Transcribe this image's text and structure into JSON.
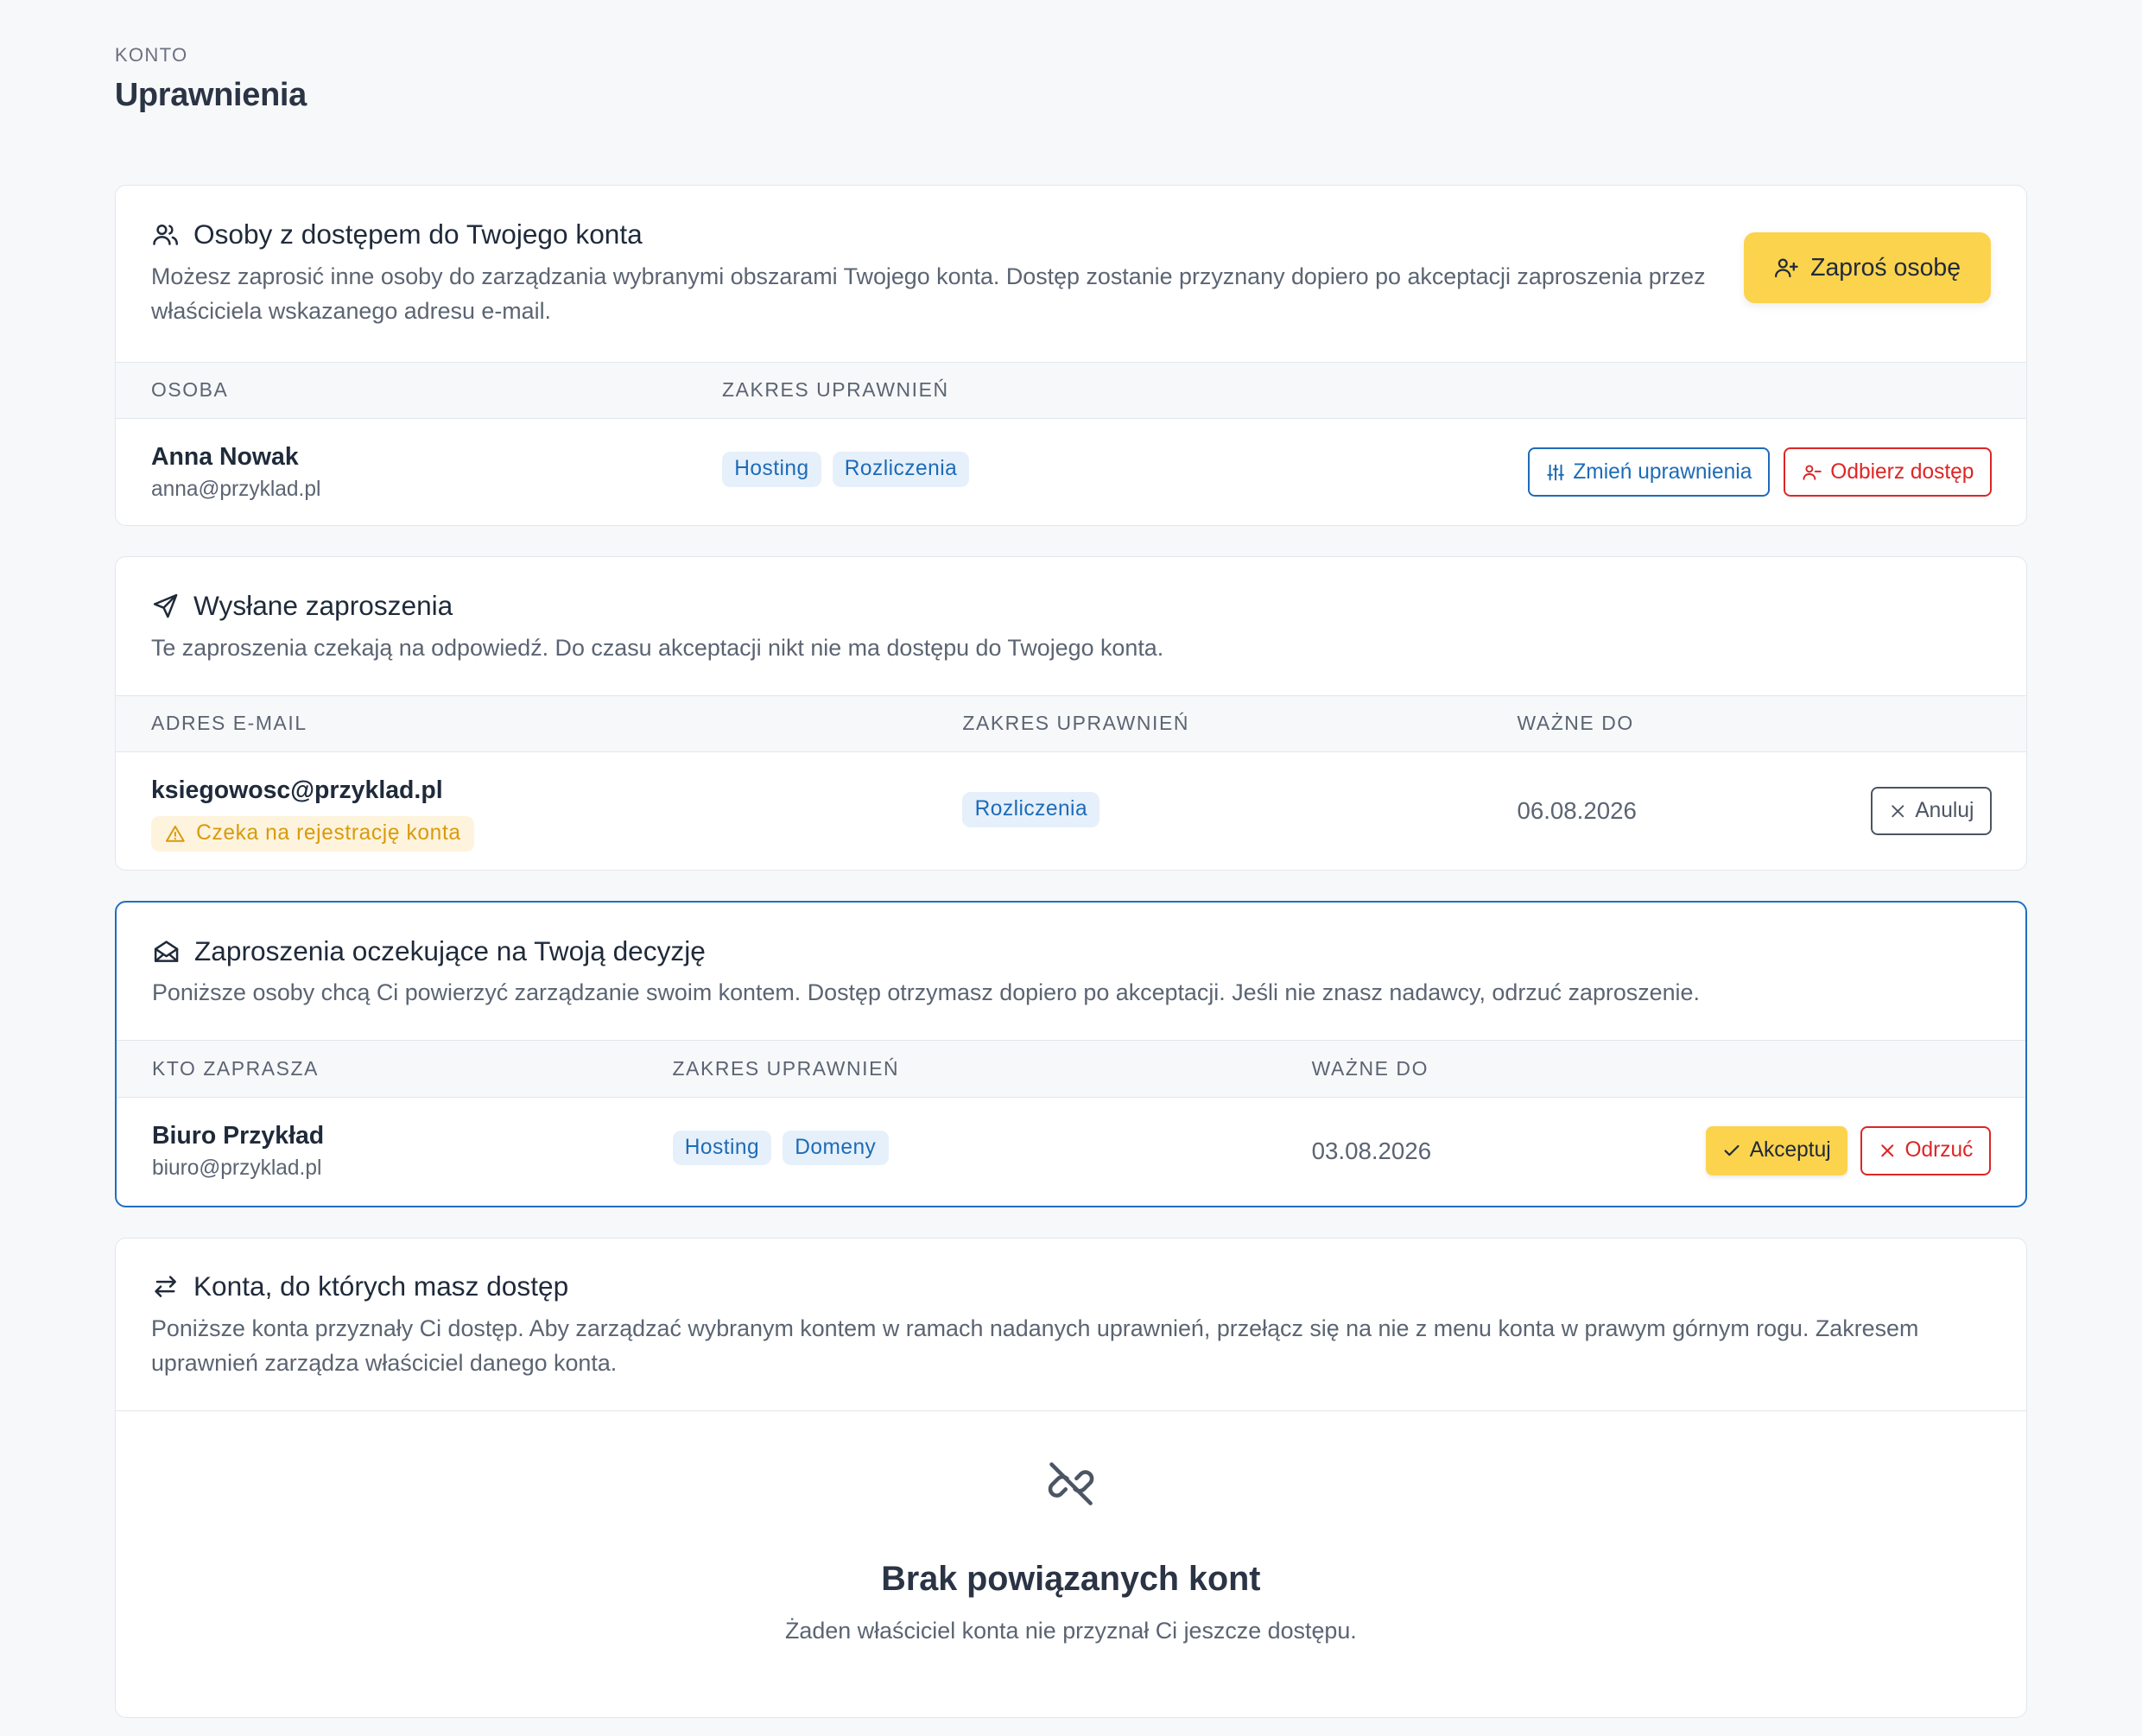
{
  "header": {
    "eyebrow": "KONTO",
    "title": "Uprawnienia"
  },
  "section_access": {
    "title": "Osoby z dostępem do Twojego konta",
    "description": "Możesz zaprosić inne osoby do zarządzania wybranymi obszarami Twojego konta. Dostęp zostanie przyznany dopiero po akceptacji zaproszenia przez właściciela wskazanego adresu e-mail.",
    "invite_label": "Zaproś osobę",
    "columns": [
      "OSOBA",
      "ZAKRES UPRAWNIEŃ"
    ],
    "rows": [
      {
        "name": "Anna Nowak",
        "email": "anna@przyklad.pl",
        "tags": [
          "Hosting",
          "Rozliczenia"
        ],
        "change_label": "Zmień uprawnienia",
        "revoke_label": "Odbierz dostęp"
      }
    ]
  },
  "section_sent": {
    "title": "Wysłane zaproszenia",
    "description": "Te zaproszenia czekają na odpowiedź. Do czasu akceptacji nikt nie ma dostępu do Twojego konta.",
    "columns": [
      "ADRES E-MAIL",
      "ZAKRES UPRAWNIEŃ",
      "WAŻNE DO"
    ],
    "rows": [
      {
        "email": "ksiegowosc@przyklad.pl",
        "status": "Czeka na rejestrację konta",
        "tags": [
          "Rozliczenia"
        ],
        "valid_until": "06.08.2026",
        "cancel_label": "Anuluj"
      }
    ]
  },
  "section_pending": {
    "title": "Zaproszenia oczekujące na Twoją decyzję",
    "description": "Poniższe osoby chcą Ci powierzyć zarządzanie swoim kontem. Dostęp otrzymasz dopiero po akceptacji. Jeśli nie znasz nadawcy, odrzuć zaproszenie.",
    "columns": [
      "KTO ZAPRASZA",
      "ZAKRES UPRAWNIEŃ",
      "WAŻNE DO"
    ],
    "rows": [
      {
        "name": "Biuro Przykład",
        "email": "biuro@przyklad.pl",
        "tags": [
          "Hosting",
          "Domeny"
        ],
        "valid_until": "03.08.2026",
        "accept_label": "Akceptuj",
        "reject_label": "Odrzuć"
      }
    ]
  },
  "section_linked": {
    "title": "Konta, do których masz dostęp",
    "description": "Poniższe konta przyznały Ci dostęp. Aby zarządzać wybranym kontem w ramach nadanych uprawnień, przełącz się na nie z menu konta w prawym górnym rogu. Zakresem uprawnień zarządza właściciel danego konta.",
    "empty_title": "Brak powiązanych kont",
    "empty_description": "Żaden właściciel konta nie przyznał Ci jeszcze dostępu."
  },
  "colors": {
    "accent_yellow": "#fcd34d",
    "link_blue": "#1d6bb8",
    "danger_red": "#dc2626",
    "warning_amber": "#d99a0b"
  },
  "icons": [
    "users-icon",
    "user-plus-icon",
    "sliders-icon",
    "user-minus-icon",
    "send-icon",
    "close-icon",
    "warning-icon",
    "mail-open-icon",
    "check-icon",
    "arrows-swap-icon",
    "link-broken-icon"
  ]
}
